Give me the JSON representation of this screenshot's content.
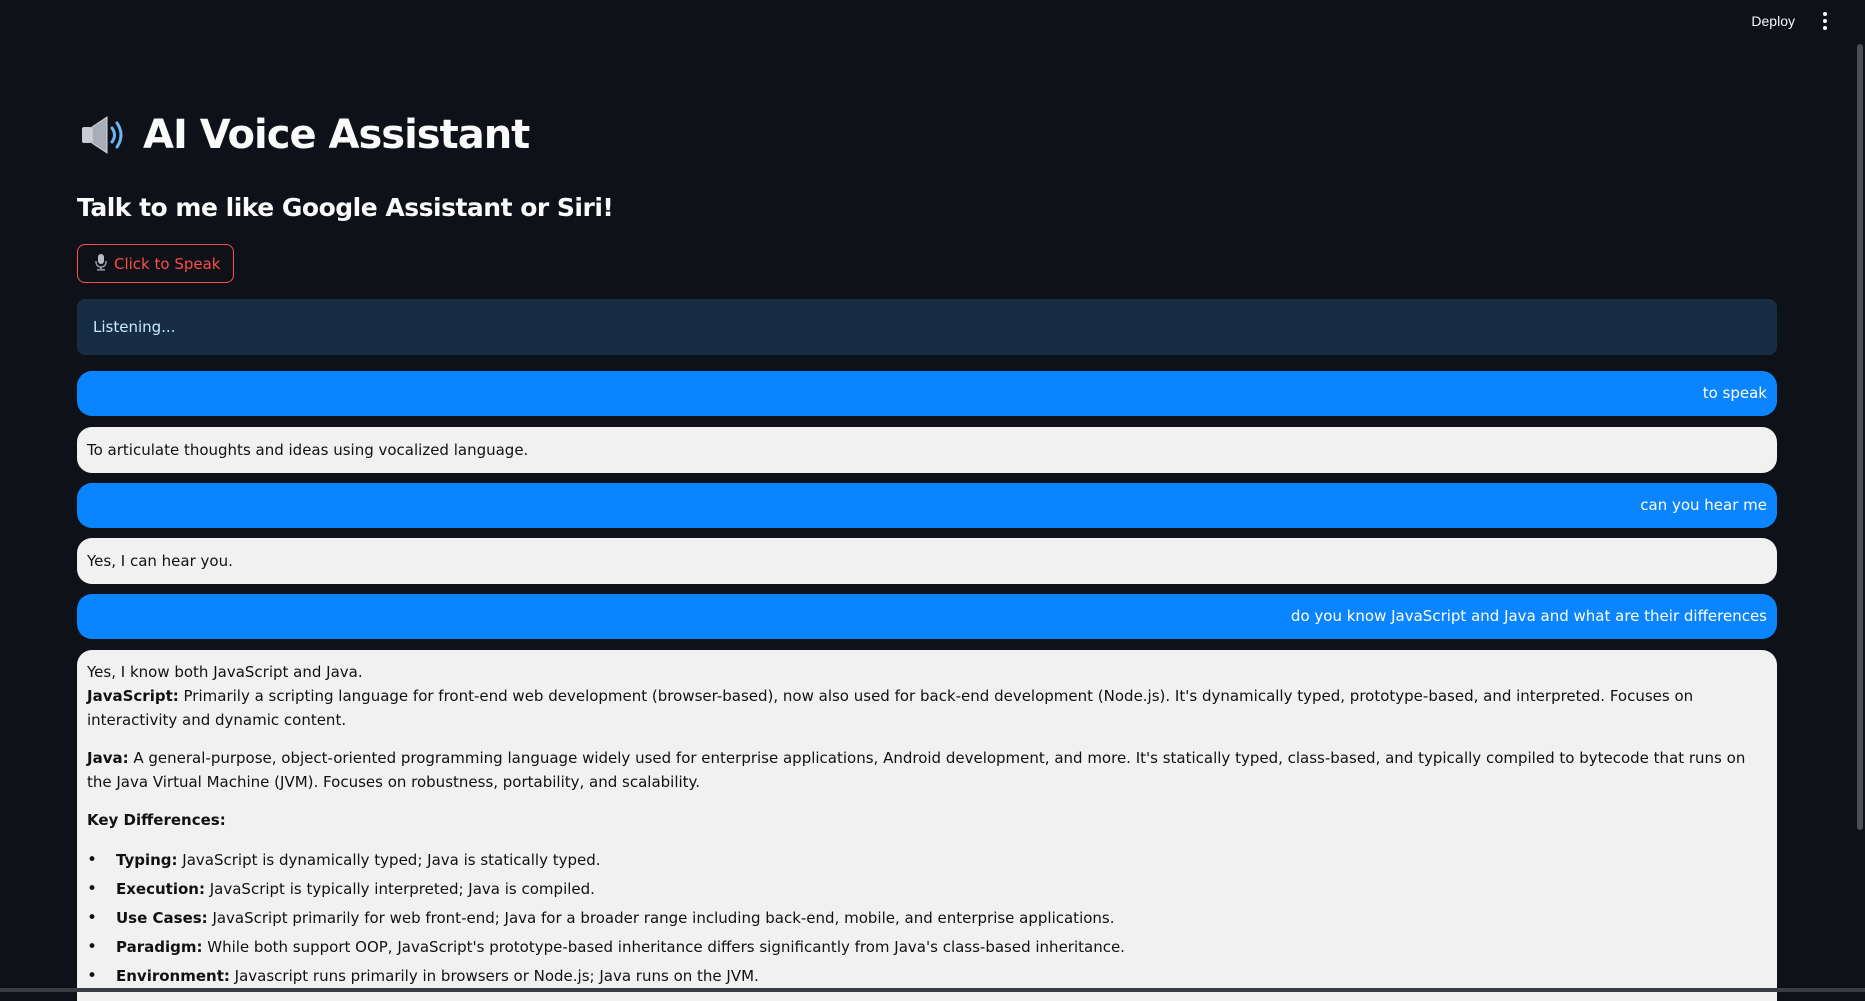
{
  "toolbar": {
    "deploy_label": "Deploy",
    "menu_icon": "more-vert-icon"
  },
  "header": {
    "icon": "speaker-icon",
    "title": "AI Voice Assistant",
    "subtitle": "Talk to me like Google Assistant or Siri!"
  },
  "speak_button": {
    "icon": "microphone-icon",
    "label": "Click to Speak"
  },
  "status": {
    "text": "Listening..."
  },
  "colors": {
    "user_bubble": "#0a84ff",
    "bot_bubble": "#f1f1f1",
    "accent_red": "#ff4b4b",
    "info_bg": "#172d43",
    "page_bg": "#0e1117"
  },
  "chat": {
    "m1": {
      "role": "user",
      "text": "to speak"
    },
    "m2": {
      "role": "assistant",
      "text": "To articulate thoughts and ideas using vocalized language."
    },
    "m3": {
      "role": "user",
      "text": "can you hear me"
    },
    "m4": {
      "role": "assistant",
      "text": "Yes, I can hear you."
    },
    "m5": {
      "role": "user",
      "text": "do you know JavaScript and Java and what are their differences"
    },
    "m6": {
      "role": "assistant",
      "intro": "Yes, I know both JavaScript and Java.",
      "js_label": "JavaScript:",
      "js_text": " Primarily a scripting language for front-end web development (browser-based), now also used for back-end development (Node.js). It's dynamically typed, prototype-based, and interpreted. Focuses on interactivity and dynamic content.",
      "java_label": "Java:",
      "java_text": " A general-purpose, object-oriented programming language widely used for enterprise applications, Android development, and more. It's statically typed, class-based, and typically compiled to bytecode that runs on the Java Virtual Machine (JVM). Focuses on robustness, portability, and scalability.",
      "diff_heading": "Key Differences:",
      "differences": [
        {
          "label": "Typing:",
          "text": " JavaScript is dynamically typed; Java is statically typed."
        },
        {
          "label": "Execution:",
          "text": " JavaScript is typically interpreted; Java is compiled."
        },
        {
          "label": "Use Cases:",
          "text": " JavaScript primarily for web front-end; Java for a broader range including back-end, mobile, and enterprise applications."
        },
        {
          "label": "Paradigm:",
          "text": " While both support OOP, JavaScript's prototype-based inheritance differs significantly from Java's class-based inheritance."
        },
        {
          "label": "Environment:",
          "text": " Javascript runs primarily in browsers or Node.js; Java runs on the JVM."
        }
      ]
    }
  }
}
